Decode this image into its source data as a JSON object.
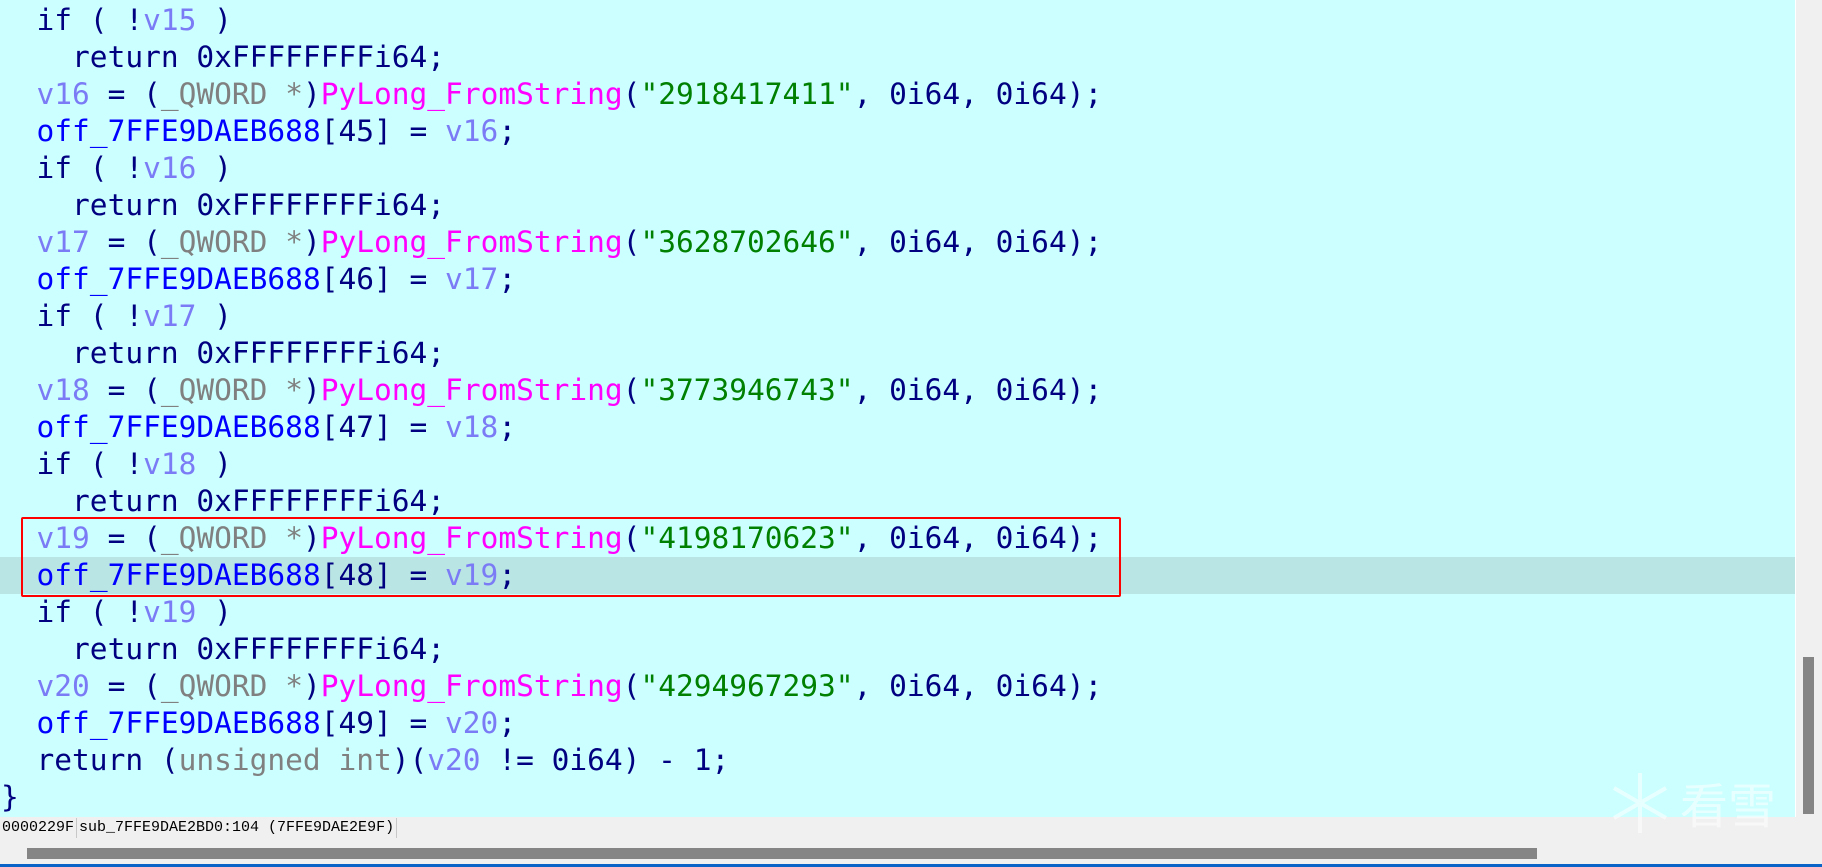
{
  "editor": {
    "highlighted_line": 15,
    "colors": {
      "background": "#ccffff",
      "highlight": "#b9e5e5",
      "keyword": "#000080",
      "variable": "#7b7bf5",
      "global": "#0000ff",
      "function": "#ff00ff",
      "string": "#008000",
      "type": "#808080",
      "annotation_box": "#ff0000"
    },
    "lines": [
      [
        [
          "k",
          "  if ( !"
        ],
        [
          "v",
          "v15"
        ],
        [
          "k",
          " )"
        ]
      ],
      [
        [
          "k",
          "    return 0xFFFFFFFFi64;"
        ]
      ],
      [
        [
          "k",
          "  "
        ],
        [
          "v",
          "v16"
        ],
        [
          "k",
          " = ("
        ],
        [
          "t",
          "_QWORD *"
        ],
        [
          "k",
          ")"
        ],
        [
          "f",
          "PyLong_FromString"
        ],
        [
          "k",
          "("
        ],
        [
          "s",
          "\"2918417411\""
        ],
        [
          "k",
          ", 0i64, 0i64);"
        ]
      ],
      [
        [
          "k",
          "  "
        ],
        [
          "g",
          "off_7FFE9DAEB688"
        ],
        [
          "k",
          "[45] = "
        ],
        [
          "v",
          "v16"
        ],
        [
          "k",
          ";"
        ]
      ],
      [
        [
          "k",
          "  if ( !"
        ],
        [
          "v",
          "v16"
        ],
        [
          "k",
          " )"
        ]
      ],
      [
        [
          "k",
          "    return 0xFFFFFFFFi64;"
        ]
      ],
      [
        [
          "k",
          "  "
        ],
        [
          "v",
          "v17"
        ],
        [
          "k",
          " = ("
        ],
        [
          "t",
          "_QWORD *"
        ],
        [
          "k",
          ")"
        ],
        [
          "f",
          "PyLong_FromString"
        ],
        [
          "k",
          "("
        ],
        [
          "s",
          "\"3628702646\""
        ],
        [
          "k",
          ", 0i64, 0i64);"
        ]
      ],
      [
        [
          "k",
          "  "
        ],
        [
          "g",
          "off_7FFE9DAEB688"
        ],
        [
          "k",
          "[46] = "
        ],
        [
          "v",
          "v17"
        ],
        [
          "k",
          ";"
        ]
      ],
      [
        [
          "k",
          "  if ( !"
        ],
        [
          "v",
          "v17"
        ],
        [
          "k",
          " )"
        ]
      ],
      [
        [
          "k",
          "    return 0xFFFFFFFFi64;"
        ]
      ],
      [
        [
          "k",
          "  "
        ],
        [
          "v",
          "v18"
        ],
        [
          "k",
          " = ("
        ],
        [
          "t",
          "_QWORD *"
        ],
        [
          "k",
          ")"
        ],
        [
          "f",
          "PyLong_FromString"
        ],
        [
          "k",
          "("
        ],
        [
          "s",
          "\"3773946743\""
        ],
        [
          "k",
          ", 0i64, 0i64);"
        ]
      ],
      [
        [
          "k",
          "  "
        ],
        [
          "g",
          "off_7FFE9DAEB688"
        ],
        [
          "k",
          "[47] = "
        ],
        [
          "v",
          "v18"
        ],
        [
          "k",
          ";"
        ]
      ],
      [
        [
          "k",
          "  if ( !"
        ],
        [
          "v",
          "v18"
        ],
        [
          "k",
          " )"
        ]
      ],
      [
        [
          "k",
          "    return 0xFFFFFFFFi64;"
        ]
      ],
      [
        [
          "k",
          "  "
        ],
        [
          "v",
          "v19"
        ],
        [
          "k",
          " = ("
        ],
        [
          "t",
          "_QWORD *"
        ],
        [
          "k",
          ")"
        ],
        [
          "f",
          "PyLong_FromString"
        ],
        [
          "k",
          "("
        ],
        [
          "s",
          "\"4198170623\""
        ],
        [
          "k",
          ", 0i64, 0i64);"
        ]
      ],
      [
        [
          "k",
          "  "
        ],
        [
          "g",
          "off_7FFE9DAEB688"
        ],
        [
          "k",
          "[48] = "
        ],
        [
          "v",
          "v19"
        ],
        [
          "k",
          ";"
        ]
      ],
      [
        [
          "k",
          "  if ( !"
        ],
        [
          "v",
          "v19"
        ],
        [
          "k",
          " )"
        ]
      ],
      [
        [
          "k",
          "    return 0xFFFFFFFFi64;"
        ]
      ],
      [
        [
          "k",
          "  "
        ],
        [
          "v",
          "v20"
        ],
        [
          "k",
          " = ("
        ],
        [
          "t",
          "_QWORD *"
        ],
        [
          "k",
          ")"
        ],
        [
          "f",
          "PyLong_FromString"
        ],
        [
          "k",
          "("
        ],
        [
          "s",
          "\"4294967293\""
        ],
        [
          "k",
          ", 0i64, 0i64);"
        ]
      ],
      [
        [
          "k",
          "  "
        ],
        [
          "g",
          "off_7FFE9DAEB688"
        ],
        [
          "k",
          "[49] = "
        ],
        [
          "v",
          "v20"
        ],
        [
          "k",
          ";"
        ]
      ],
      [
        [
          "k",
          "  return ("
        ],
        [
          "t",
          "unsigned int"
        ],
        [
          "k",
          ")("
        ],
        [
          "v",
          "v20"
        ],
        [
          "k",
          " != 0i64) - 1;"
        ]
      ],
      [
        [
          "k",
          "}"
        ]
      ]
    ]
  },
  "status": {
    "offset": "0000229F",
    "location": "sub_7FFE9DAE2BD0:104 (7FFE9DAE2E9F)"
  },
  "watermark": {
    "text": "看雪",
    "icon": "snowflake-icon"
  }
}
